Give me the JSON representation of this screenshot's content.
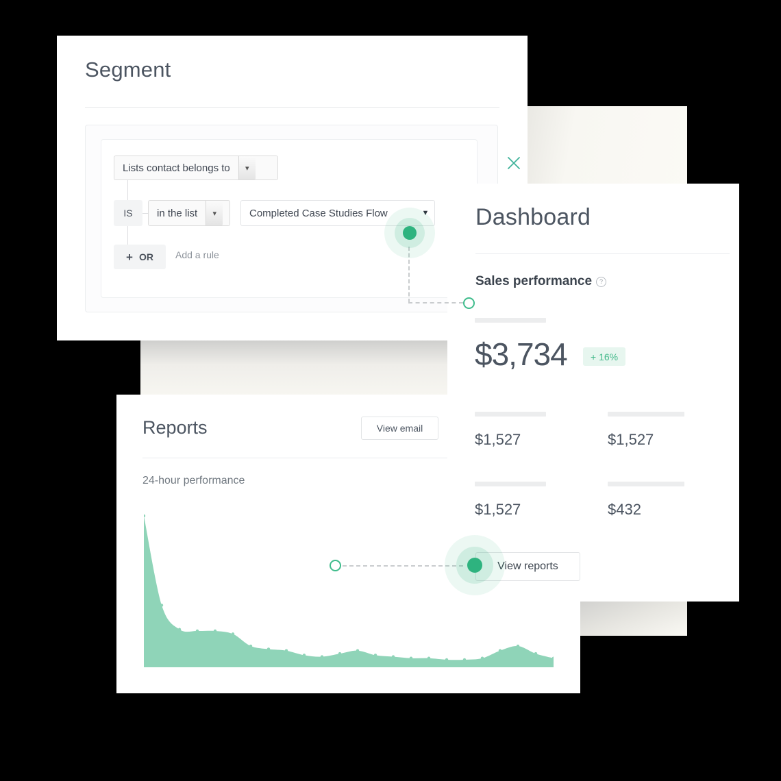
{
  "theme": {
    "accent_green": "#2eb37f",
    "accent_mint": "#8fd4b8",
    "badge_green": "#43b98a",
    "text_dark": "#4c5561",
    "text_muted": "#8b9199"
  },
  "segment": {
    "title": "Segment",
    "field_select": {
      "value": "Lists contact belongs to",
      "caret": "chevron-down"
    },
    "condition_chip": "IS",
    "operator_select": {
      "value": "in the list",
      "caret": "chevron-down"
    },
    "value_select": {
      "value": "Completed Case Studies Flow",
      "caret": "caret-down"
    },
    "or_chip": {
      "plus": "+",
      "label": "OR"
    },
    "add_rule_label": "Add a rule",
    "close_label": "×"
  },
  "reports": {
    "title": "Reports",
    "view_email_label": "View email",
    "subtitle": "24-hour performance"
  },
  "dashboard": {
    "title": "Dashboard",
    "section_label": "Sales performance",
    "help_glyph": "?",
    "primary_value": "$3,734",
    "delta_badge": "+ 16%",
    "metrics": [
      {
        "value": "$1,527"
      },
      {
        "value": "$1,527"
      },
      {
        "value": "$1,527"
      },
      {
        "value": "$432"
      }
    ],
    "view_reports_label": "View reports"
  },
  "chart_data": {
    "type": "area",
    "title": "24-hour performance",
    "xlabel": "",
    "ylabel": "",
    "grid": "vertical-only",
    "legend": "none",
    "series_color": "#8fd4b8",
    "x": [
      0,
      1,
      2,
      3,
      4,
      5,
      6,
      7,
      8,
      9,
      10,
      11,
      12,
      13,
      14,
      15,
      16,
      17,
      18,
      19,
      20,
      21,
      22,
      23
    ],
    "values": [
      100,
      41,
      25,
      24,
      24,
      22,
      14,
      12,
      11,
      8,
      7,
      9,
      11,
      8,
      7,
      6,
      6,
      5,
      5,
      6,
      11,
      14,
      9,
      6
    ],
    "ylim": [
      0,
      100
    ],
    "xlim": [
      0,
      23
    ],
    "gridline_count": 12
  },
  "hotspots": [
    {
      "name": "value-select-hotspot"
    },
    {
      "name": "view-reports-hotspot"
    }
  ]
}
